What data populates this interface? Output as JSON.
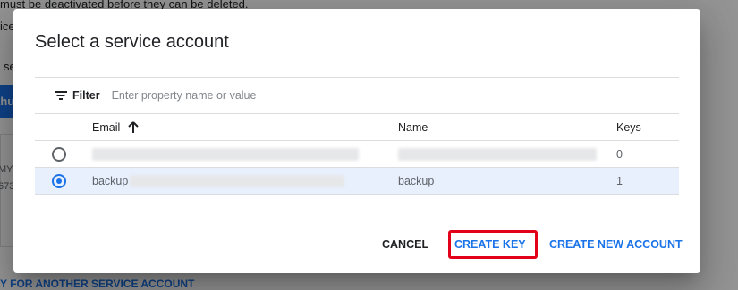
{
  "background": {
    "top_text": "must be deactivated before they can be deleted.",
    "fragment_1": "ice",
    "fragment_2": "se",
    "button_fragment": "thu",
    "card_line_1": "MY",
    "card_line_2": "673",
    "bottom_link": "Y FOR ANOTHER SERVICE ACCOUNT"
  },
  "dialog": {
    "title": "Select a service account",
    "filter": {
      "label": "Filter",
      "placeholder": "Enter property name or value"
    },
    "columns": {
      "email": "Email",
      "name": "Name",
      "keys": "Keys"
    },
    "rows": [
      {
        "email": "",
        "name": "",
        "keys": "0",
        "selected": false
      },
      {
        "email": "backup",
        "name": "backup",
        "keys": "1",
        "selected": true
      }
    ],
    "actions": {
      "cancel": "CANCEL",
      "create_key": "CREATE KEY",
      "create_new_account": "CREATE NEW ACCOUNT"
    }
  },
  "colors": {
    "accent": "#1a73e8",
    "highlight": "#e3001b",
    "selected_row": "#e8f0fe"
  },
  "icons": [
    "filter-icon",
    "arrow-up-icon",
    "radio-icon"
  ]
}
